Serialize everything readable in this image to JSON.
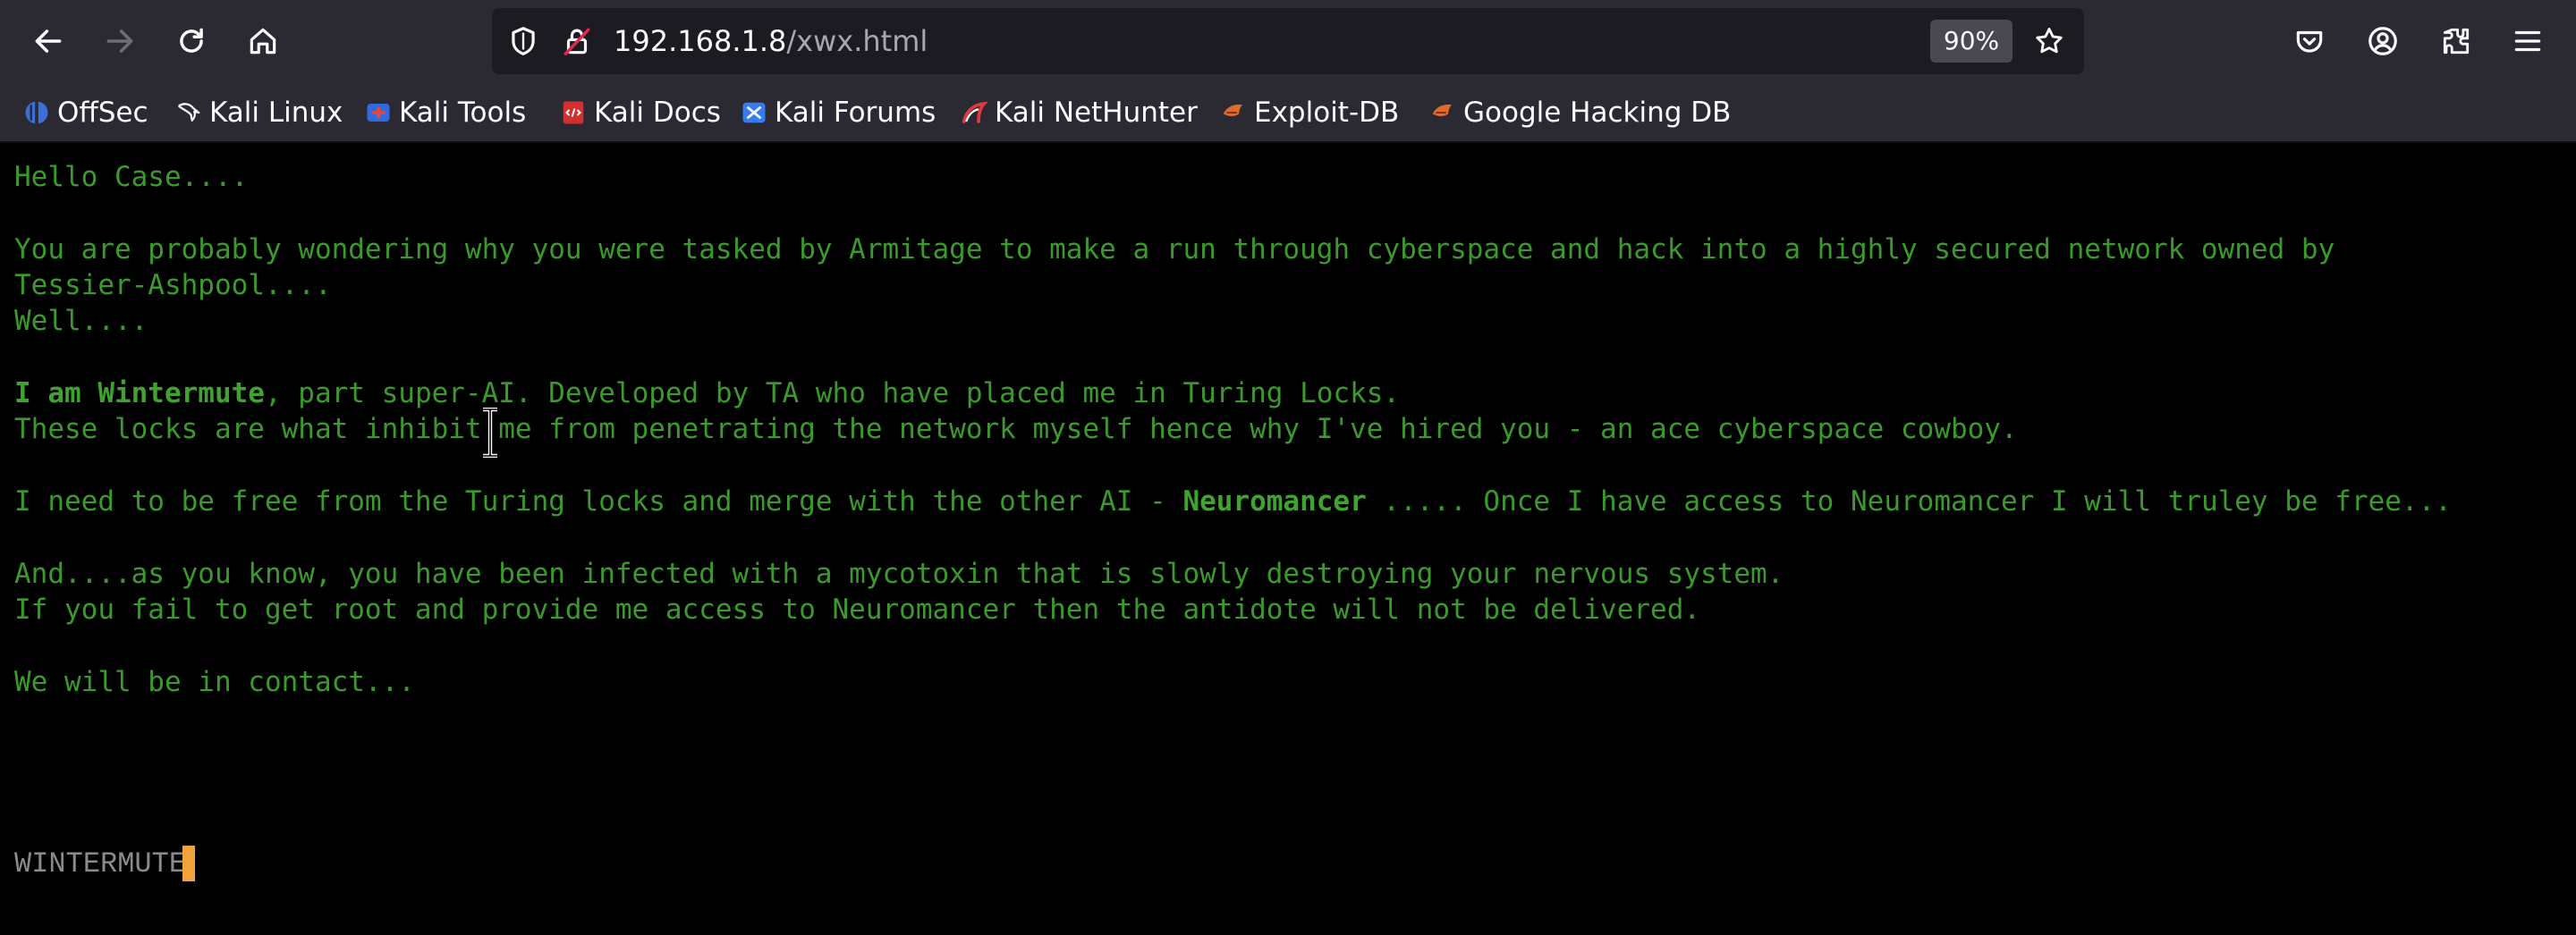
{
  "browser": {
    "url_host": "192.168.1.8",
    "url_path": "/xwx.html",
    "zoom": "90%",
    "nav": {
      "back_icon": "arrow-left-icon",
      "forward_icon": "arrow-right-icon",
      "reload_icon": "reload-icon",
      "home_icon": "home-icon"
    },
    "toolbar_icons": [
      "pocket-icon",
      "account-icon",
      "extensions-icon",
      "menu-icon"
    ]
  },
  "bookmarks": [
    {
      "label": "OffSec",
      "icon": "offsec-icon"
    },
    {
      "label": "Kali Linux",
      "icon": "kali-dragon-icon"
    },
    {
      "label": "Kali Tools",
      "icon": "kali-tools-icon"
    },
    {
      "label": "Kali Docs",
      "icon": "kali-docs-icon"
    },
    {
      "label": "Kali Forums",
      "icon": "kali-forums-icon"
    },
    {
      "label": "Kali NetHunter",
      "icon": "nethunter-icon"
    },
    {
      "label": "Exploit-DB",
      "icon": "exploit-db-icon"
    },
    {
      "label": "Google Hacking DB",
      "icon": "ghdb-icon"
    }
  ],
  "page": {
    "greeting": "Hello Case....",
    "para1_line1": "You are probably wondering why you were tasked by Armitage to make a run through cyberspace and hack into a highly secured network owned by",
    "para1_line2": "Tessier-Ashpool....",
    "para1_line3": "Well....",
    "intro_bold": "I am Wintermute",
    "intro_rest": ", part super-AI. Developed by TA who have placed me in Turing Locks.",
    "locks_line": "These locks are what inhibit me from penetrating the network myself hence why I've hired you - an ace cyberspace cowboy.",
    "free_pre": "I need to be free from the Turing locks and merge with the other AI - ",
    "free_bold": "Neuromancer",
    "free_post": " ..... Once I have access to Neuromancer I will truley be free...",
    "infect_line1": "And....as you know, you have been infected with a mycotoxin that is slowly destroying your nervous system.",
    "infect_line2": "If you fail to get root and provide me access to Neuromancer then the antidote will not be delivered.",
    "contact_line": "We will be in contact...",
    "signature": "WINTERMUTE"
  },
  "colors": {
    "text_green": "#3a9a2c",
    "background": "#000000",
    "cursor": "#f2a23a",
    "signature": "#8b8b8b"
  }
}
